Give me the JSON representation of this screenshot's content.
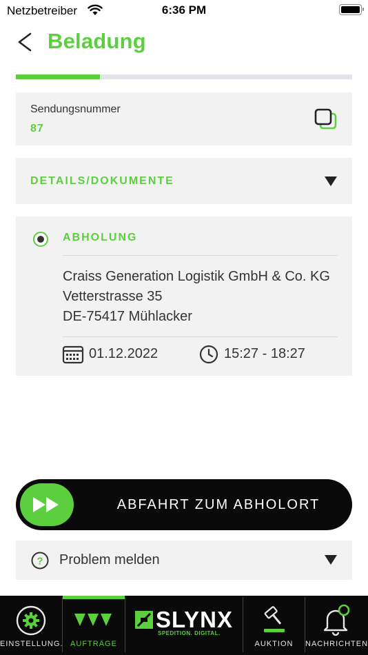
{
  "status_bar": {
    "carrier": "Netzbetreiber",
    "time": "6:36 PM"
  },
  "header": {
    "title": "Beladung",
    "back_icon": "chevron-left-icon"
  },
  "progress": {
    "fraction": 0.25,
    "color": "#5ccf3e",
    "track_color": "#e3e3ea"
  },
  "shipment": {
    "label": "Sendungsnummer",
    "number": "87",
    "copy_icon": "copy-icon"
  },
  "details": {
    "label": "DETAILS/DOKUMENTE",
    "icon": "caret-down-icon"
  },
  "pickup": {
    "label": "ABHOLUNG",
    "company": "Craiss Generation Logistik GmbH & Co. KG",
    "street": "Vetterstrasse 35",
    "city": "DE-75417 Mühlacker",
    "date": "01.12.2022",
    "time_window": "15:27 - 18:27",
    "date_icon": "calendar-icon",
    "time_icon": "clock-icon"
  },
  "action": {
    "label": "ABFAHRT ZUM ABHOLORT",
    "icon": "fast-forward-icon"
  },
  "problem": {
    "label": "Problem melden",
    "icon": "help-icon"
  },
  "tab_bar": {
    "tabs": [
      {
        "label": "EINSTELLUNG...",
        "icon": "gear-icon",
        "active": false
      },
      {
        "label": "AUFTRÄGE",
        "icon": "orders-icon",
        "active": true
      },
      {
        "label": "",
        "icon": "slynx-logo",
        "active": false
      },
      {
        "label": "AUKTION",
        "icon": "gavel-icon",
        "active": false
      },
      {
        "label": "NACHRICHTEN",
        "icon": "bell-icon",
        "active": false
      }
    ],
    "logo": {
      "name": "SLYNX",
      "tagline": "SPEDITION. DIGITAL."
    }
  },
  "colors": {
    "brand_green": "#5ccf3e",
    "card_background": "#f2f2f2",
    "tab_bar_background": "#0a0a0a"
  }
}
